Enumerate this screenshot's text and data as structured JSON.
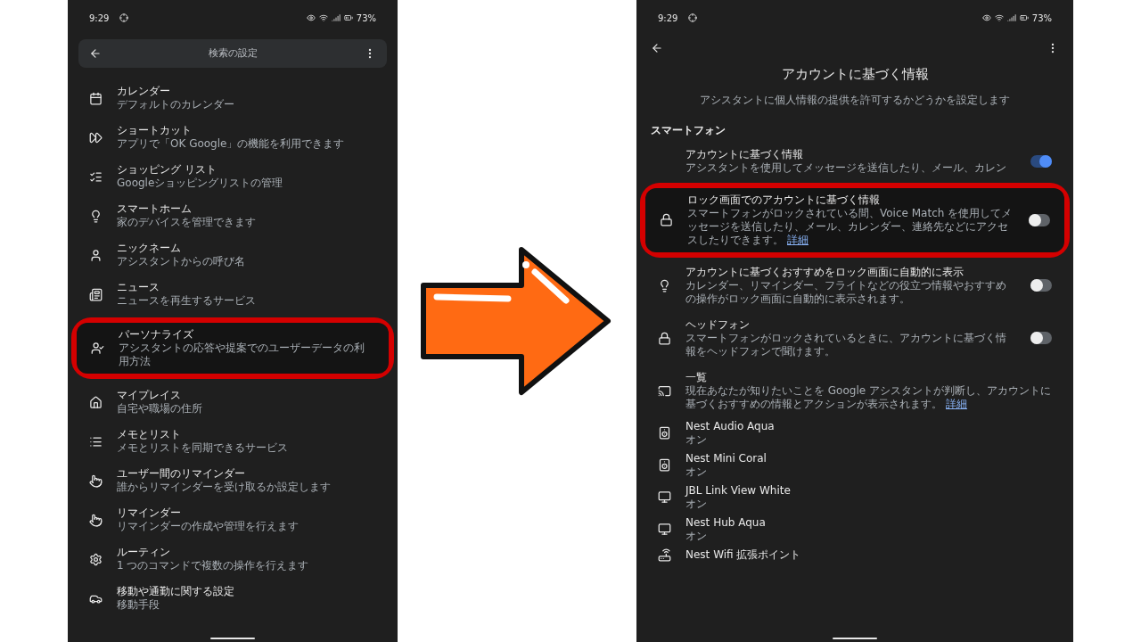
{
  "left_screen": {
    "status_bar": {
      "time": "9:29",
      "battery": "73%"
    },
    "toolbar": {
      "title": "検索の設定"
    },
    "items": [
      {
        "title": "カレンダー",
        "subtitle": "デフォルトのカレンダー",
        "highlighted": false
      },
      {
        "title": "ショートカット",
        "subtitle": "アプリで「OK Google」の機能を利用できます",
        "highlighted": false
      },
      {
        "title": "ショッピング リスト",
        "subtitle": "Googleショッピングリストの管理",
        "highlighted": false
      },
      {
        "title": "スマートホーム",
        "subtitle": "家のデバイスを管理できます",
        "highlighted": false
      },
      {
        "title": "ニックネーム",
        "subtitle": "アシスタントからの呼び名",
        "highlighted": false
      },
      {
        "title": "ニュース",
        "subtitle": "ニュースを再生するサービス",
        "highlighted": false
      },
      {
        "title": "パーソナライズ",
        "subtitle": "アシスタントの応答や提案でのユーザーデータの利用方法",
        "highlighted": true
      },
      {
        "title": "マイプレイス",
        "subtitle": "自宅や職場の住所",
        "highlighted": false
      },
      {
        "title": "メモとリスト",
        "subtitle": "メモとリストを同期できるサービス",
        "highlighted": false
      },
      {
        "title": "ユーザー間のリマインダー",
        "subtitle": "誰からリマインダーを受け取るか設定します",
        "highlighted": false
      },
      {
        "title": "リマインダー",
        "subtitle": "リマインダーの作成や管理を行えます",
        "highlighted": false
      },
      {
        "title": "ルーティン",
        "subtitle": "1 つのコマンドで複数の操作を行えます",
        "highlighted": false
      },
      {
        "title": "移動や通勤に関する設定",
        "subtitle": "移動手段",
        "highlighted": false
      }
    ]
  },
  "right_screen": {
    "status_bar": {
      "time": "9:29",
      "battery": "73%"
    },
    "title": "アカウントに基づく情報",
    "description": "アシスタントに個人情報の提供を許可するかどうかを設定します",
    "section": "スマートフォン",
    "settings": [
      {
        "kind": "toggle",
        "title": "アカウントに基づく情報",
        "subtitle": "アシスタントを使用してメッセージを送信したり、メール、カレン",
        "on": true,
        "highlighted": false
      },
      {
        "kind": "toggle",
        "title": "ロック画面でのアカウントに基づく情報",
        "subtitle": "スマートフォンがロックされている間、Voice Match を使用してメッセージを送信したり、メール、カレンダー、連絡先などにアクセスしたりできます。",
        "link": "詳細",
        "on": false,
        "highlighted": true
      },
      {
        "kind": "toggle",
        "title": "アカウントに基づくおすすめをロック画面に自動的に表示",
        "subtitle": "カレンダー、リマインダー、フライトなどの役立つ情報やおすすめの操作がロック画面に自動的に表示されます。",
        "on": false,
        "highlighted": false
      },
      {
        "kind": "toggle",
        "title": "ヘッドフォン",
        "subtitle": "スマートフォンがロックされているときに、アカウントに基づく情報をヘッドフォンで聞けます。",
        "on": false,
        "highlighted": false
      },
      {
        "kind": "info",
        "title": "一覧",
        "subtitle": "現在あなたが知りたいことを Google アシスタントが判断し、アカウントに基づくおすすめの情報とアクションが表示されます。",
        "link": "詳細",
        "highlighted": false
      }
    ],
    "devices": [
      {
        "name": "Nest Audio Aqua",
        "status": "オン"
      },
      {
        "name": "Nest Mini Coral",
        "status": "オン"
      },
      {
        "name": "JBL Link View White",
        "status": "オン"
      },
      {
        "name": "Nest Hub Aqua",
        "status": "オン"
      },
      {
        "name": "Nest Wifi 拡張ポイント"
      }
    ]
  }
}
